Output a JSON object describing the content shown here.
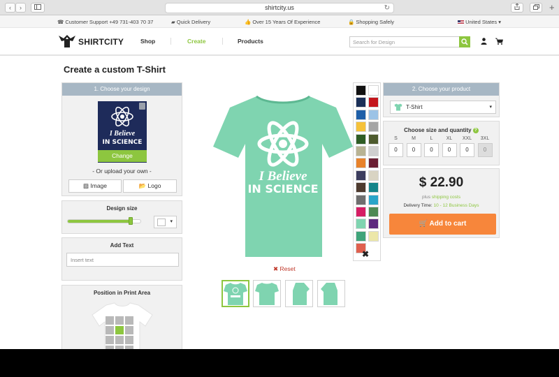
{
  "browser": {
    "url": "shirtcity.us",
    "back_label": "‹",
    "forward_label": "›"
  },
  "infobar": {
    "support": "Customer Support +49 731-403 70 37",
    "delivery": "Quick Delivery",
    "experience": "Over 15 Years Of Experience",
    "shopping": "Shopping Safely",
    "region": "United States"
  },
  "nav": {
    "logo": "SHIRTCITY",
    "links": [
      "Shop",
      "Create",
      "Products"
    ],
    "active": "Create",
    "search_placeholder": "Search for Design"
  },
  "page": {
    "title": "Create a custom T-Shirt"
  },
  "design_panel": {
    "header": "1. Choose your design",
    "design_line1": "I Believe",
    "design_line2": "IN SCIENCE",
    "change_label": "Change",
    "or_upload": "- Or upload your own -",
    "image_label": "Image",
    "logo_label": "Logo"
  },
  "design_size": {
    "title": "Design size",
    "level": 0.86
  },
  "add_text": {
    "title": "Add Text",
    "placeholder": "Insert text"
  },
  "position": {
    "title": "Position in Print Area"
  },
  "preview": {
    "shirt_color": "#7fd4b0",
    "print_line1": "I Believe",
    "print_line2": "IN SCIENCE",
    "reset_label": "Reset"
  },
  "palette": {
    "colors": [
      "#111111",
      "#ffffff",
      "#1a2f57",
      "#c4161c",
      "#1e5fa8",
      "#9cc3e6",
      "#f5c23a",
      "#a5a5a5",
      "#2f5d25",
      "#4e5b2e",
      "#b8b393",
      "#cfcfcf",
      "#e8822a",
      "#6b1f33",
      "#3c3d5e",
      "#d9d4c3",
      "#4d3a2e",
      "#15858a",
      "#6e6e6e",
      "#2aa5c9",
      "#d61c63",
      "#4e8a54",
      "#7fd4b0",
      "#5e2a7e",
      "#3fa47a",
      "#ece7a8",
      "#e0604e"
    ],
    "close_label": "✖"
  },
  "product_panel": {
    "header": "2. Choose your product",
    "product": "T-Shirt"
  },
  "size_panel": {
    "title": "Choose size and quantity",
    "sizes": [
      "S",
      "M",
      "L",
      "XL",
      "XXL",
      "3XL"
    ],
    "quantities": [
      "0",
      "0",
      "0",
      "0",
      "0",
      "0"
    ]
  },
  "price_panel": {
    "price": "$ 22.90",
    "plus_text": "plus",
    "shipping_link": "shipping costs",
    "delivery_label": "Delivery Time:",
    "delivery_value": "10 - 12 Business Days",
    "cart_label": "Add to cart"
  },
  "colors": {
    "accent": "#8dc63f",
    "panel_header": "#a7b7c4",
    "cart": "#f7863b",
    "reset": "#c0392b"
  }
}
